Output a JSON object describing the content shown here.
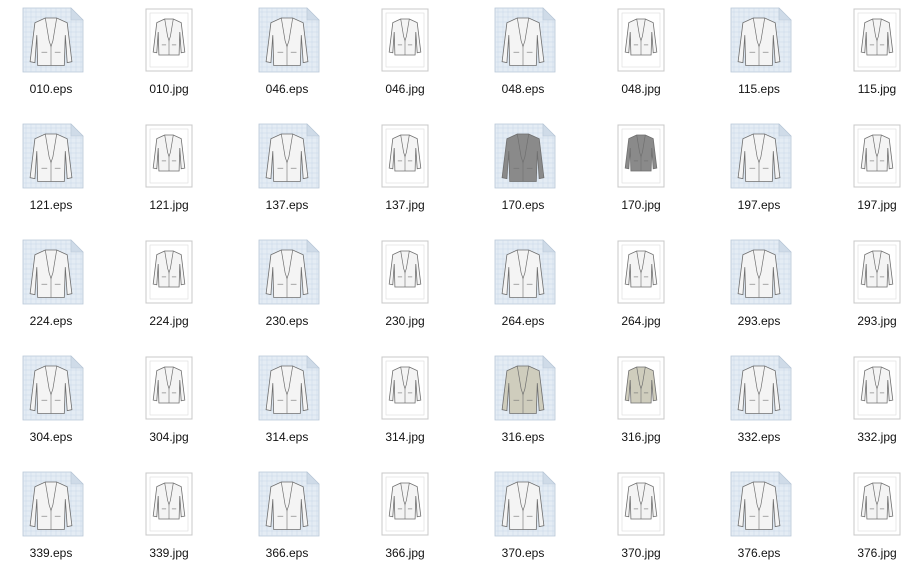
{
  "files": [
    {
      "name": "010.eps",
      "kind": "eps",
      "tone": "light"
    },
    {
      "name": "010.jpg",
      "kind": "jpg",
      "tone": "light"
    },
    {
      "name": "046.eps",
      "kind": "eps",
      "tone": "light"
    },
    {
      "name": "046.jpg",
      "kind": "jpg",
      "tone": "light"
    },
    {
      "name": "048.eps",
      "kind": "eps",
      "tone": "light"
    },
    {
      "name": "048.jpg",
      "kind": "jpg",
      "tone": "light"
    },
    {
      "name": "115.eps",
      "kind": "eps",
      "tone": "light"
    },
    {
      "name": "115.jpg",
      "kind": "jpg",
      "tone": "light"
    },
    {
      "name": "121.eps",
      "kind": "eps",
      "tone": "light"
    },
    {
      "name": "121.jpg",
      "kind": "jpg",
      "tone": "light"
    },
    {
      "name": "137.eps",
      "kind": "eps",
      "tone": "light"
    },
    {
      "name": "137.jpg",
      "kind": "jpg",
      "tone": "light"
    },
    {
      "name": "170.eps",
      "kind": "eps",
      "tone": "dark"
    },
    {
      "name": "170.jpg",
      "kind": "jpg",
      "tone": "dark"
    },
    {
      "name": "197.eps",
      "kind": "eps",
      "tone": "light"
    },
    {
      "name": "197.jpg",
      "kind": "jpg",
      "tone": "light"
    },
    {
      "name": "224.eps",
      "kind": "eps",
      "tone": "light"
    },
    {
      "name": "224.jpg",
      "kind": "jpg",
      "tone": "light"
    },
    {
      "name": "230.eps",
      "kind": "eps",
      "tone": "light"
    },
    {
      "name": "230.jpg",
      "kind": "jpg",
      "tone": "light"
    },
    {
      "name": "264.eps",
      "kind": "eps",
      "tone": "light"
    },
    {
      "name": "264.jpg",
      "kind": "jpg",
      "tone": "light"
    },
    {
      "name": "293.eps",
      "kind": "eps",
      "tone": "light"
    },
    {
      "name": "293.jpg",
      "kind": "jpg",
      "tone": "light"
    },
    {
      "name": "304.eps",
      "kind": "eps",
      "tone": "light"
    },
    {
      "name": "304.jpg",
      "kind": "jpg",
      "tone": "light"
    },
    {
      "name": "314.eps",
      "kind": "eps",
      "tone": "light"
    },
    {
      "name": "314.jpg",
      "kind": "jpg",
      "tone": "light"
    },
    {
      "name": "316.eps",
      "kind": "eps",
      "tone": "beige"
    },
    {
      "name": "316.jpg",
      "kind": "jpg",
      "tone": "beige"
    },
    {
      "name": "332.eps",
      "kind": "eps",
      "tone": "light"
    },
    {
      "name": "332.jpg",
      "kind": "jpg",
      "tone": "light"
    },
    {
      "name": "339.eps",
      "kind": "eps",
      "tone": "light"
    },
    {
      "name": "339.jpg",
      "kind": "jpg",
      "tone": "light"
    },
    {
      "name": "366.eps",
      "kind": "eps",
      "tone": "light"
    },
    {
      "name": "366.jpg",
      "kind": "jpg",
      "tone": "light"
    },
    {
      "name": "370.eps",
      "kind": "eps",
      "tone": "light"
    },
    {
      "name": "370.jpg",
      "kind": "jpg",
      "tone": "light"
    },
    {
      "name": "376.eps",
      "kind": "eps",
      "tone": "light"
    },
    {
      "name": "376.jpg",
      "kind": "jpg",
      "tone": "light"
    }
  ],
  "colors": {
    "label": "#111111",
    "eps_page": "#e4ecf4",
    "eps_grid": "#c9d8e8",
    "eps_fold": "#cfdbe8",
    "jpg_frame": "#ffffff",
    "jpg_border": "#c8c8c8",
    "jacket_light": "#f4f4f4",
    "jacket_dark": "#8a8a8a",
    "jacket_beige": "#cfcdbd",
    "jacket_stroke": "#6f6f6f"
  }
}
